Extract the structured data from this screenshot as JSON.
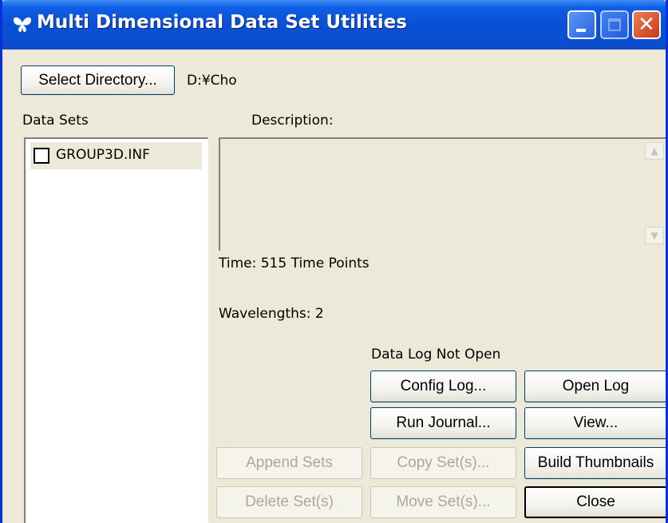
{
  "window": {
    "title": "Multi Dimensional Data Set Utilities",
    "app_icon": "butterfly-icon",
    "controls": [
      "minimize-icon",
      "maximize-icon",
      "close-icon"
    ],
    "close_glyph": "✕",
    "colors": {
      "title_bar": "#0a4fd6",
      "face": "#ece9d8",
      "close_button": "#d6522b"
    }
  },
  "directory": {
    "select_label": "Select Directory...",
    "path": "D:¥Cho"
  },
  "data_sets": {
    "heading": "Data Sets",
    "items": [
      {
        "label": "GROUP3D.INF",
        "checked": false
      }
    ]
  },
  "description": {
    "heading": "Description:",
    "text": ""
  },
  "info": {
    "time": "Time: 515 Time Points",
    "wavelengths": "Wavelengths: 2"
  },
  "data_log": {
    "status": "Data Log Not Open"
  },
  "buttons": {
    "config_log": "Config Log...",
    "open_log": "Open Log",
    "run_journal": "Run Journal...",
    "view": "View...",
    "append_sets": "Append Sets",
    "copy_sets": "Copy Set(s)...",
    "build_thumbnails": "Build Thumbnails",
    "delete_sets": "Delete Set(s)",
    "move_sets": "Move Set(s)...",
    "close": "Close"
  }
}
